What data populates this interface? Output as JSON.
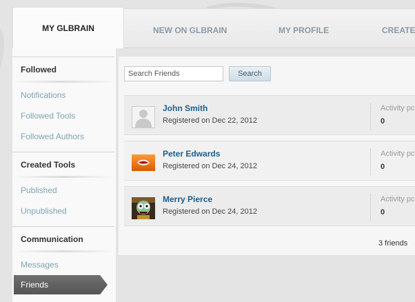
{
  "tabs": [
    {
      "label": "MY GLBRAIN",
      "active": true
    },
    {
      "label": "NEW ON GLBRAIN",
      "active": false
    },
    {
      "label": "MY PROFILE",
      "active": false
    },
    {
      "label": "CREATE C",
      "active": false
    }
  ],
  "sidebar": {
    "followed": {
      "title": "Followed",
      "items": [
        "Notifications",
        "Followed Tools",
        "Followed Authors"
      ]
    },
    "created": {
      "title": "Created Tools",
      "items": [
        "Published",
        "Unpublished"
      ]
    },
    "communication": {
      "title": "Communication",
      "items": [
        "Messages",
        "Friends"
      ],
      "active": "Friends"
    }
  },
  "search": {
    "placeholder": "Search Friends",
    "button_label": "Search"
  },
  "friends": [
    {
      "name": "John Smith",
      "registered": "Registered on Dec 22, 2012",
      "activity_label": "Activity pc",
      "activity_value": "0",
      "avatar": "default-user-icon"
    },
    {
      "name": "Peter Edwards",
      "registered": "Registered on Dec 24, 2012",
      "activity_label": "Activity pc",
      "activity_value": "0",
      "avatar": "lips-photo"
    },
    {
      "name": "Merry Pierce",
      "registered": "Registered on Dec 24, 2012",
      "activity_label": "Activity pc",
      "activity_value": "0",
      "avatar": "zombie-cartoon-photo"
    }
  ],
  "friend_count": "3 friends",
  "colors": {
    "link": "#1e5d8a",
    "sidebar_link": "#7fa4b3",
    "active_item_bg": "#5f5f5f"
  }
}
